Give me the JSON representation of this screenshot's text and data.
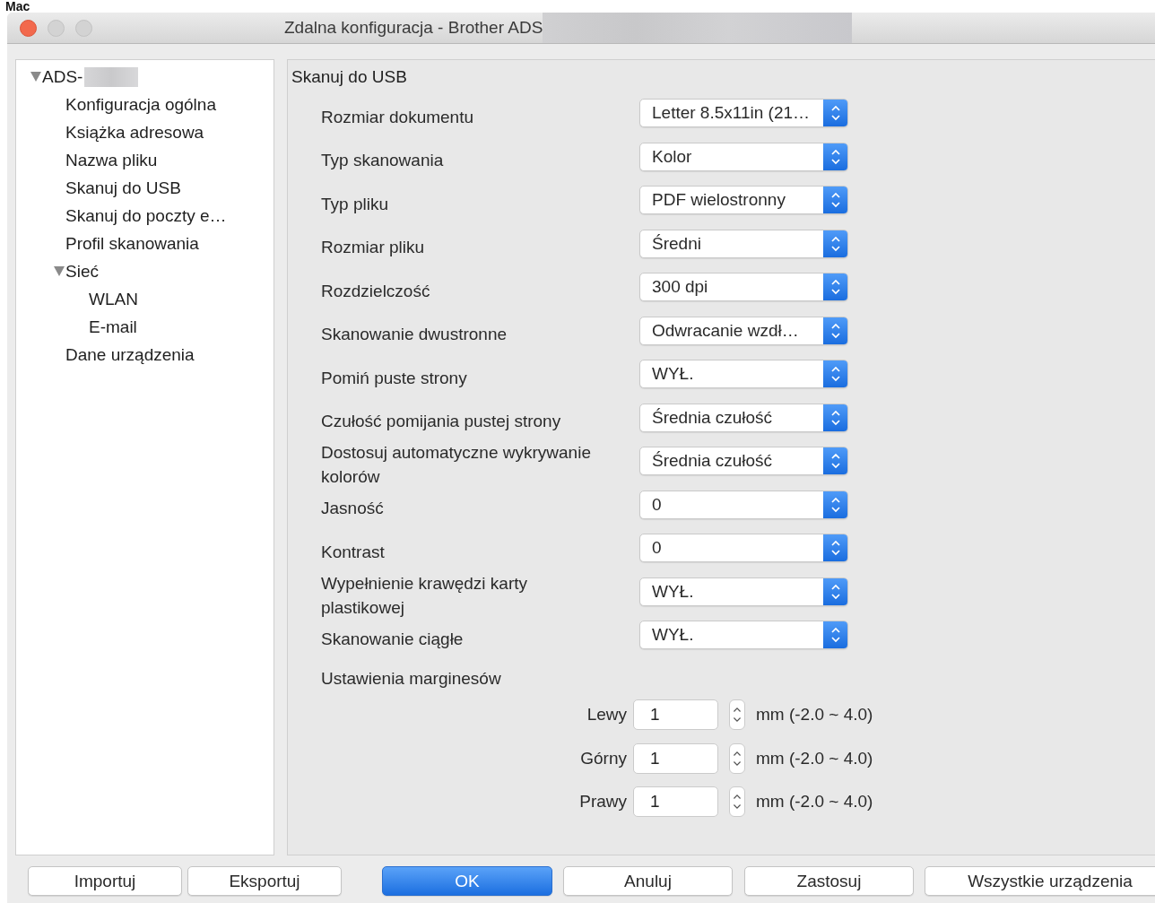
{
  "header": "Mac",
  "window": {
    "title": "Zdalna konfiguracja - Brother ADS"
  },
  "sidebar": {
    "tree": [
      {
        "label": "ADS-",
        "expanded": true,
        "children": [
          {
            "label": "Konfiguracja ogólna"
          },
          {
            "label": "Książka adresowa"
          },
          {
            "label": "Nazwa pliku"
          },
          {
            "label": "Skanuj do USB"
          },
          {
            "label": "Skanuj do poczty e…"
          },
          {
            "label": "Profil skanowania"
          },
          {
            "label": "Sieć",
            "expanded": true,
            "children": [
              {
                "label": "WLAN"
              },
              {
                "label": "E-mail"
              }
            ]
          },
          {
            "label": "Dane urządzenia"
          }
        ]
      }
    ]
  },
  "panel": {
    "title": "Skanuj do USB",
    "settings": [
      {
        "label": "Rozmiar dokumentu",
        "value": "Letter 8.5x11in (21…"
      },
      {
        "label": "Typ skanowania",
        "value": "Kolor"
      },
      {
        "label": "Typ pliku",
        "value": "PDF wielostronny"
      },
      {
        "label": "Rozmiar pliku",
        "value": "Średni"
      },
      {
        "label": "Rozdzielczość",
        "value": "300 dpi"
      },
      {
        "label": "Skanowanie dwustronne",
        "value": "Odwracanie wzdł…"
      },
      {
        "label": "Pomiń puste strony",
        "value": "WYŁ."
      },
      {
        "label": "Czułość pomijania pustej strony",
        "value": "Średnia czułość"
      },
      {
        "label": "Dostosuj automatyczne wykrywanie kolorów",
        "value": "Średnia czułość"
      },
      {
        "label": "Jasność",
        "value": "0"
      },
      {
        "label": "Kontrast",
        "value": "0"
      },
      {
        "label": "Wypełnienie krawędzi karty plastikowej",
        "value": "WYŁ."
      },
      {
        "label": "Skanowanie ciągłe",
        "value": "WYŁ."
      }
    ],
    "margins": {
      "title": "Ustawienia marginesów",
      "rows": [
        {
          "label": "Lewy",
          "value": "1",
          "range": "mm (-2.0 ~ 4.0)"
        },
        {
          "label": "Górny",
          "value": "1",
          "range": "mm (-2.0 ~ 4.0)"
        },
        {
          "label": "Prawy",
          "value": "1",
          "range": "mm (-2.0 ~ 4.0)"
        }
      ]
    }
  },
  "buttons": [
    {
      "label": "Importuj",
      "default": false
    },
    {
      "label": "Eksportuj",
      "default": false
    },
    {
      "label": "OK",
      "default": true
    },
    {
      "label": "Anuluj",
      "default": false
    },
    {
      "label": "Zastosuj",
      "default": false
    },
    {
      "label": "Wszystkie urządzenia",
      "default": false
    }
  ]
}
